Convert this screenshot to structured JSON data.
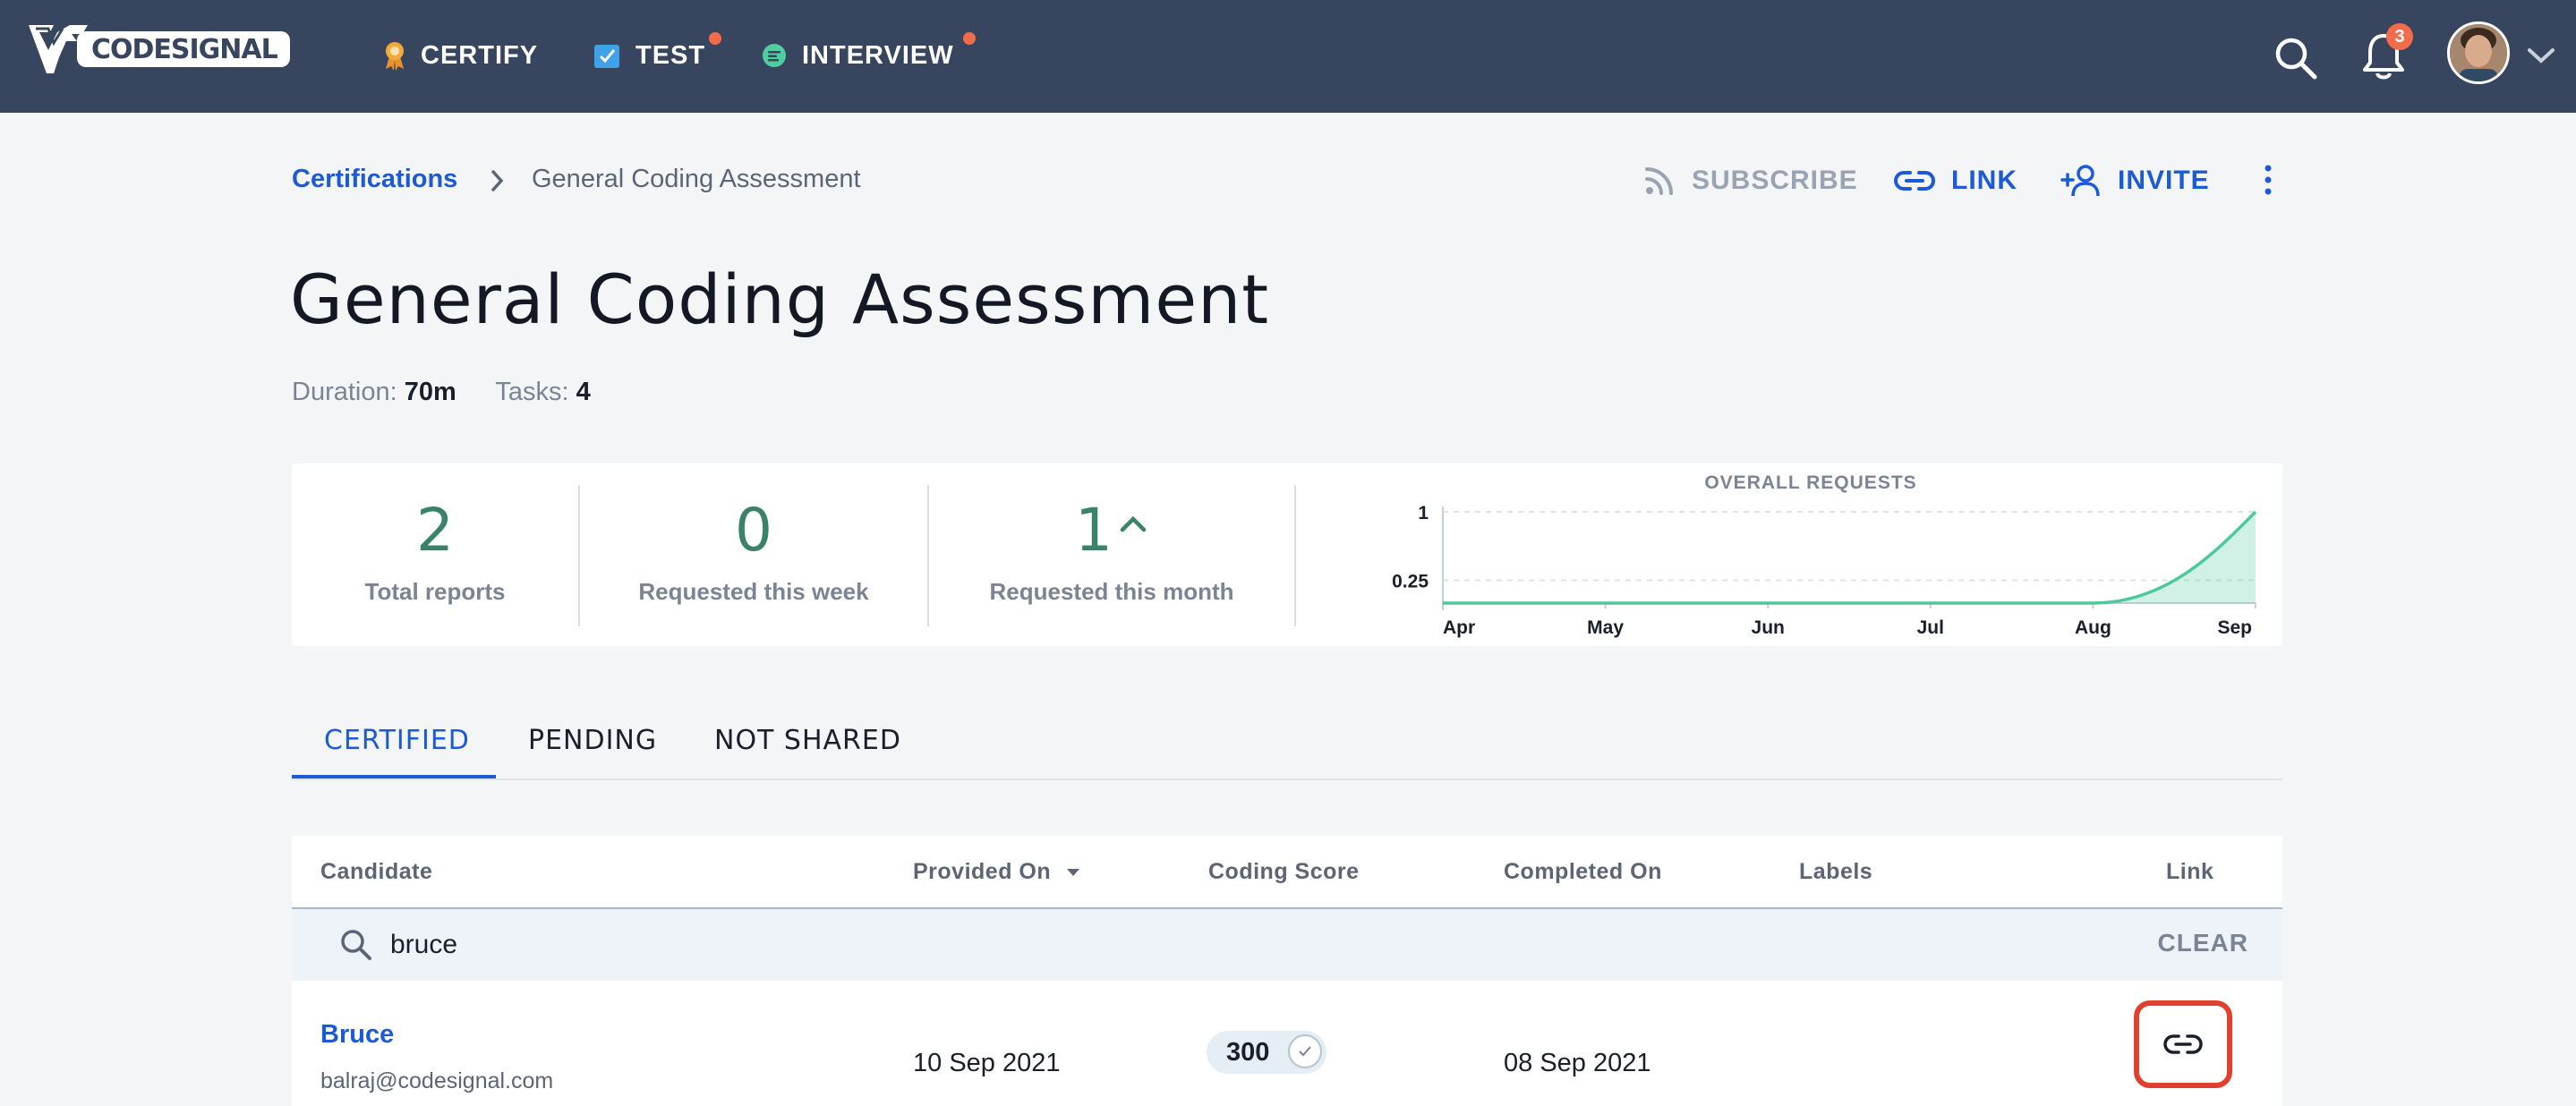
{
  "nav": {
    "brand": "CODESIGNAL",
    "items": [
      {
        "label": "CERTIFY",
        "icon": "certificate-ribbon-icon",
        "has_dot": false
      },
      {
        "label": "TEST",
        "icon": "checkbox-icon",
        "has_dot": true
      },
      {
        "label": "INTERVIEW",
        "icon": "chat-bubble-icon",
        "has_dot": true
      }
    ],
    "notification_count": "3",
    "colors": {
      "bar": "#37465e",
      "dot": "#f26b4b"
    }
  },
  "breadcrumb": {
    "parent": "Certifications",
    "current": "General Coding Assessment"
  },
  "actions": {
    "subscribe": "SUBSCRIBE",
    "link": "LINK",
    "invite": "INVITE"
  },
  "assessment": {
    "title": "General Coding Assessment",
    "duration_label": "Duration:",
    "duration_value": "70m",
    "tasks_label": "Tasks:",
    "tasks_value": "4"
  },
  "stats": [
    {
      "value": "2",
      "label": "Total reports"
    },
    {
      "value": "0",
      "label": "Requested this week"
    },
    {
      "value": "1",
      "label": "Requested this month",
      "trend": "up"
    }
  ],
  "chart_data": {
    "type": "area",
    "title": "OVERALL REQUESTS",
    "categories": [
      "Apr",
      "May",
      "Jun",
      "Jul",
      "Aug",
      "Sep"
    ],
    "yticks": [
      "1",
      "0.25"
    ],
    "ylim": [
      0,
      1
    ],
    "series": [
      {
        "values": [
          0,
          0,
          0,
          0,
          0,
          1
        ],
        "color": "#4cc99b"
      }
    ],
    "grid": "dashed horizontal"
  },
  "tabs": [
    {
      "label": "CERTIFIED",
      "active": true
    },
    {
      "label": "PENDING",
      "active": false
    },
    {
      "label": "NOT SHARED",
      "active": false
    }
  ],
  "table": {
    "columns": [
      "Candidate",
      "Provided On",
      "Coding Score",
      "Completed On",
      "Labels",
      "Link"
    ],
    "sorted_column": "Provided On",
    "search_value": "bruce",
    "clear_label": "CLEAR",
    "rows": [
      {
        "name": "Bruce",
        "email": "balraj@codesignal.com",
        "provided_on": "10 Sep 2021",
        "coding_score": "300",
        "completed_on": "08 Sep 2021",
        "labels": ""
      }
    ]
  }
}
